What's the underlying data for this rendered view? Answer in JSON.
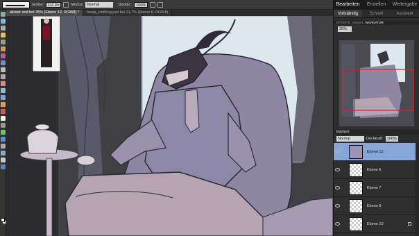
{
  "options_bar": {
    "size_label": "Größe:",
    "size_value": "111 Px",
    "mode_label": "Modus:",
    "mode_value": "Normal",
    "opacity_label": "Deckkr.:",
    "opacity_value": "100%"
  },
  "documents": [
    {
      "label": "alistair and bel 25% (Ebene 12, RGB/8) *",
      "active": true
    },
    {
      "label": "freeja_clothing.psd bei 21,7% (Ebene 8, RGB/8)",
      "active": false
    }
  ],
  "panel": {
    "top_tabs": [
      "Bearbeiten",
      "Erstellen",
      "Weitergabe"
    ],
    "mode_tabs": [
      "Vollständig",
      "Schnell",
      "Assistent"
    ],
    "sub_tabs": [
      "EFFEKTE",
      "INHALT",
      "NAVIGATOR"
    ],
    "zoom_value": "25%"
  },
  "layers": {
    "title": "EBENEN",
    "blend_mode": "Normal",
    "opacity_label": "Deckkraft:",
    "opacity_value": "100%",
    "items": [
      {
        "name": "Ebene 12",
        "active": true
      },
      {
        "name": "Ebene 6",
        "active": false
      },
      {
        "name": "Ebene 7",
        "active": false
      },
      {
        "name": "Ebene 8",
        "active": false
      },
      {
        "name": "Ebene 10",
        "active": false
      }
    ]
  },
  "colors": {
    "selected_layer": "#86a6d8",
    "navigator_frame": "#e02020"
  }
}
